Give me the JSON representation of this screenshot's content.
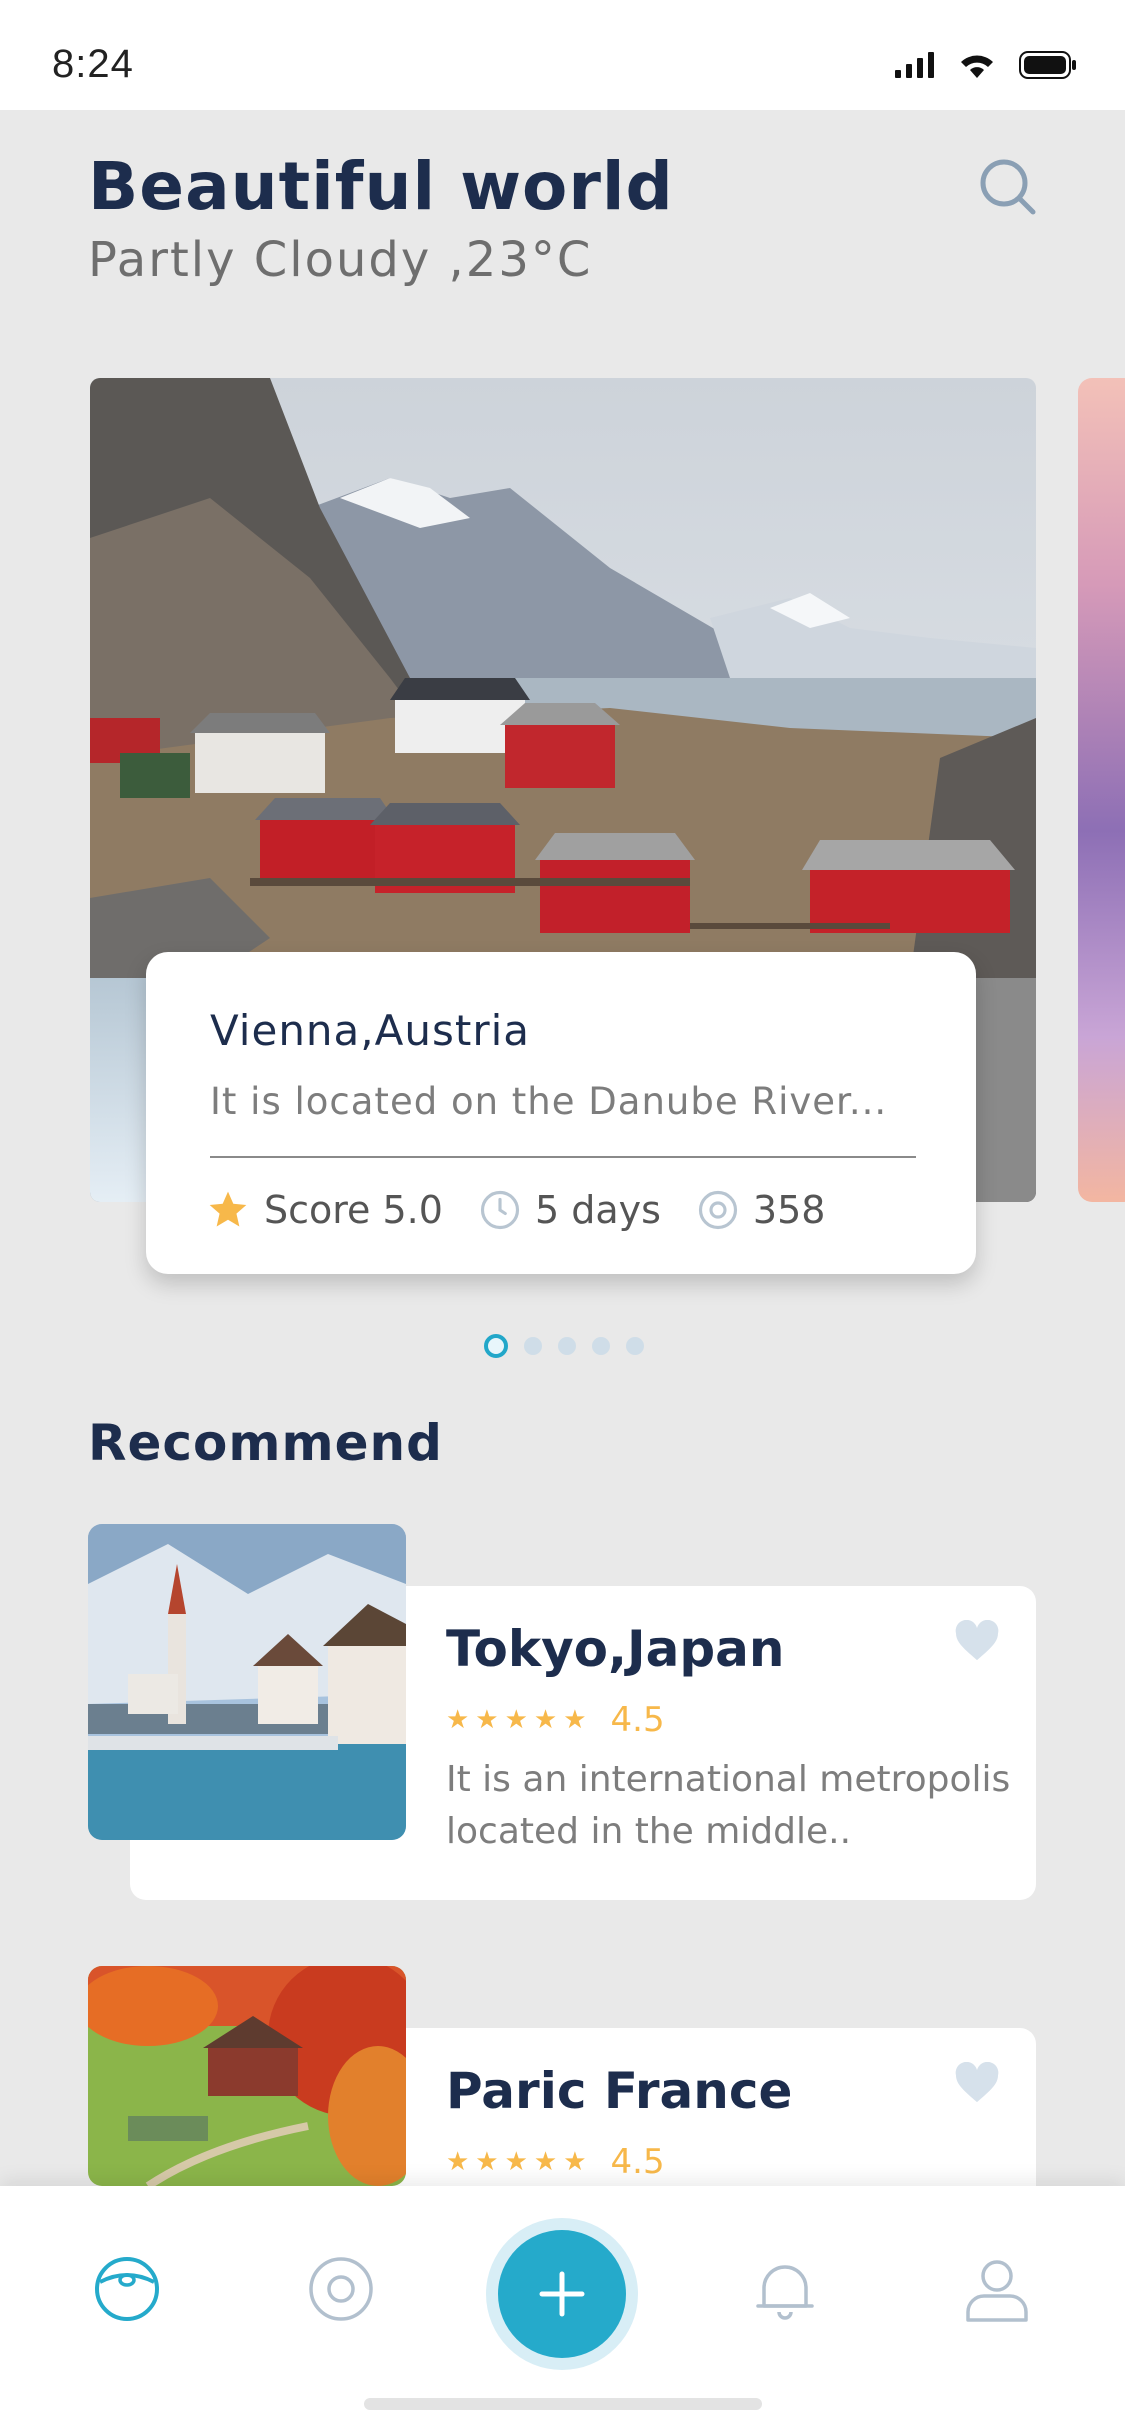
{
  "status_bar": {
    "time": "8:24"
  },
  "header": {
    "title": "Beautiful world",
    "subtitle": "Partly Cloudy ,23°C",
    "search_icon": "search-icon"
  },
  "featured": {
    "title": "Vienna,Austria",
    "description": "It is located on the Danube River...",
    "score": "Score 5.0",
    "duration": "5 days",
    "views": "358"
  },
  "pagination": {
    "count": 5,
    "active": 1
  },
  "recommend": {
    "heading": "Recommend",
    "items": [
      {
        "title": "Tokyo,Japan",
        "stars": "★★★★★",
        "rating": "4.5",
        "description_line1": "It is an international metropolis",
        "description_line2": "located in the middle.."
      },
      {
        "title": "Paric France",
        "stars": "★★★★★",
        "rating": "4.5"
      }
    ]
  },
  "tab_bar": {
    "tabs": [
      "home-icon",
      "explore-icon",
      "add-icon",
      "bell-icon",
      "profile-icon"
    ],
    "accent": "#25aacb"
  },
  "colors": {
    "primary_text": "#1d2d4d",
    "accent": "#25aacb",
    "rating": "#f7b84a",
    "background": "#e9e9e9"
  }
}
